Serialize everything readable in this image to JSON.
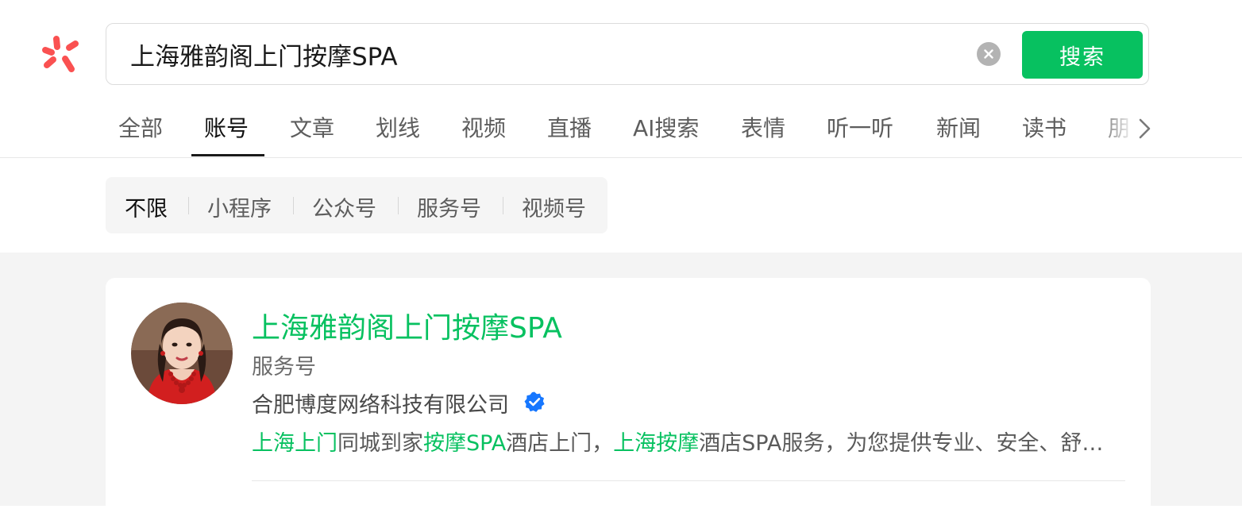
{
  "search": {
    "query": "上海雅韵阁上门按摩SPA",
    "button_label": "搜索"
  },
  "tabs": [
    {
      "label": "全部",
      "active": false
    },
    {
      "label": "账号",
      "active": true
    },
    {
      "label": "文章",
      "active": false
    },
    {
      "label": "划线",
      "active": false
    },
    {
      "label": "视频",
      "active": false
    },
    {
      "label": "直播",
      "active": false
    },
    {
      "label": "AI搜索",
      "active": false
    },
    {
      "label": "表情",
      "active": false
    },
    {
      "label": "听一听",
      "active": false
    },
    {
      "label": "新闻",
      "active": false
    },
    {
      "label": "读书",
      "active": false
    },
    {
      "label": "朋",
      "active": false
    }
  ],
  "filters": [
    {
      "label": "不限",
      "active": true
    },
    {
      "label": "小程序",
      "active": false
    },
    {
      "label": "公众号",
      "active": false
    },
    {
      "label": "服务号",
      "active": false
    },
    {
      "label": "视频号",
      "active": false
    }
  ],
  "result": {
    "name": "上海雅韵阁上门按摩SPA",
    "type": "服务号",
    "company": "合肥博度网络科技有限公司",
    "verified": true,
    "description_parts": [
      {
        "text": "上海上门",
        "highlight": true
      },
      {
        "text": "同城到家",
        "highlight": false
      },
      {
        "text": "按摩SPA",
        "highlight": true
      },
      {
        "text": "酒店上门，",
        "highlight": false
      },
      {
        "text": "上海按摩",
        "highlight": true
      },
      {
        "text": "酒店SPA服务，为您提供专业、安全、舒适的上门服务",
        "highlight": false
      }
    ]
  },
  "colors": {
    "accent": "#07c160",
    "logo": "#fa5151",
    "verified": "#1677ff"
  },
  "icons": {
    "logo": "wechat-search-logo",
    "clear": "clear-icon",
    "more": "chevron-right-icon",
    "verified": "verified-badge-icon"
  }
}
